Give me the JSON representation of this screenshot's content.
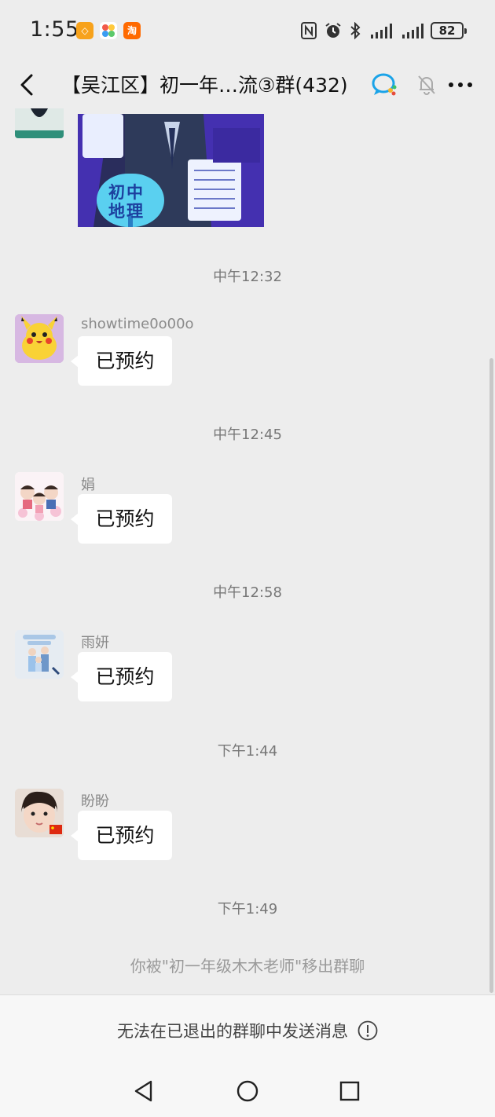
{
  "status_bar": {
    "time": "1:55",
    "battery": "82",
    "app_icons": [
      "hexagon-app-icon",
      "pinwheel-app-icon",
      "taobao-icon"
    ],
    "right_icons": [
      "nfc-icon",
      "alarm-icon",
      "bluetooth-icon",
      "signal-icon",
      "signal-icon",
      "battery-icon"
    ]
  },
  "header": {
    "title": "【吴江区】初一年…流③群(432)"
  },
  "messages": [
    {
      "type": "time",
      "text": "中午12:32"
    },
    {
      "type": "msg",
      "sender": "showtime0o00o",
      "text": "已预约"
    },
    {
      "type": "time",
      "text": "中午12:45"
    },
    {
      "type": "msg",
      "sender": "娟",
      "text": "已预约"
    },
    {
      "type": "time",
      "text": "中午12:58"
    },
    {
      "type": "msg",
      "sender": "雨妍",
      "text": "已预约"
    },
    {
      "type": "time",
      "text": "下午1:44"
    },
    {
      "type": "msg",
      "sender": "盼盼",
      "text": "已预约"
    },
    {
      "type": "time",
      "text": "下午1:49"
    },
    {
      "type": "system",
      "text": "你被\"初一年级木木老师\"移出群聊"
    }
  ],
  "prev_image": {
    "caption": "初中 地理"
  },
  "bottom": {
    "notice": "无法在已退出的群聊中发送消息"
  },
  "colors": {
    "background": "#ededed",
    "bubble": "#ffffff",
    "title_icon_blue": "#1aa3e8"
  }
}
